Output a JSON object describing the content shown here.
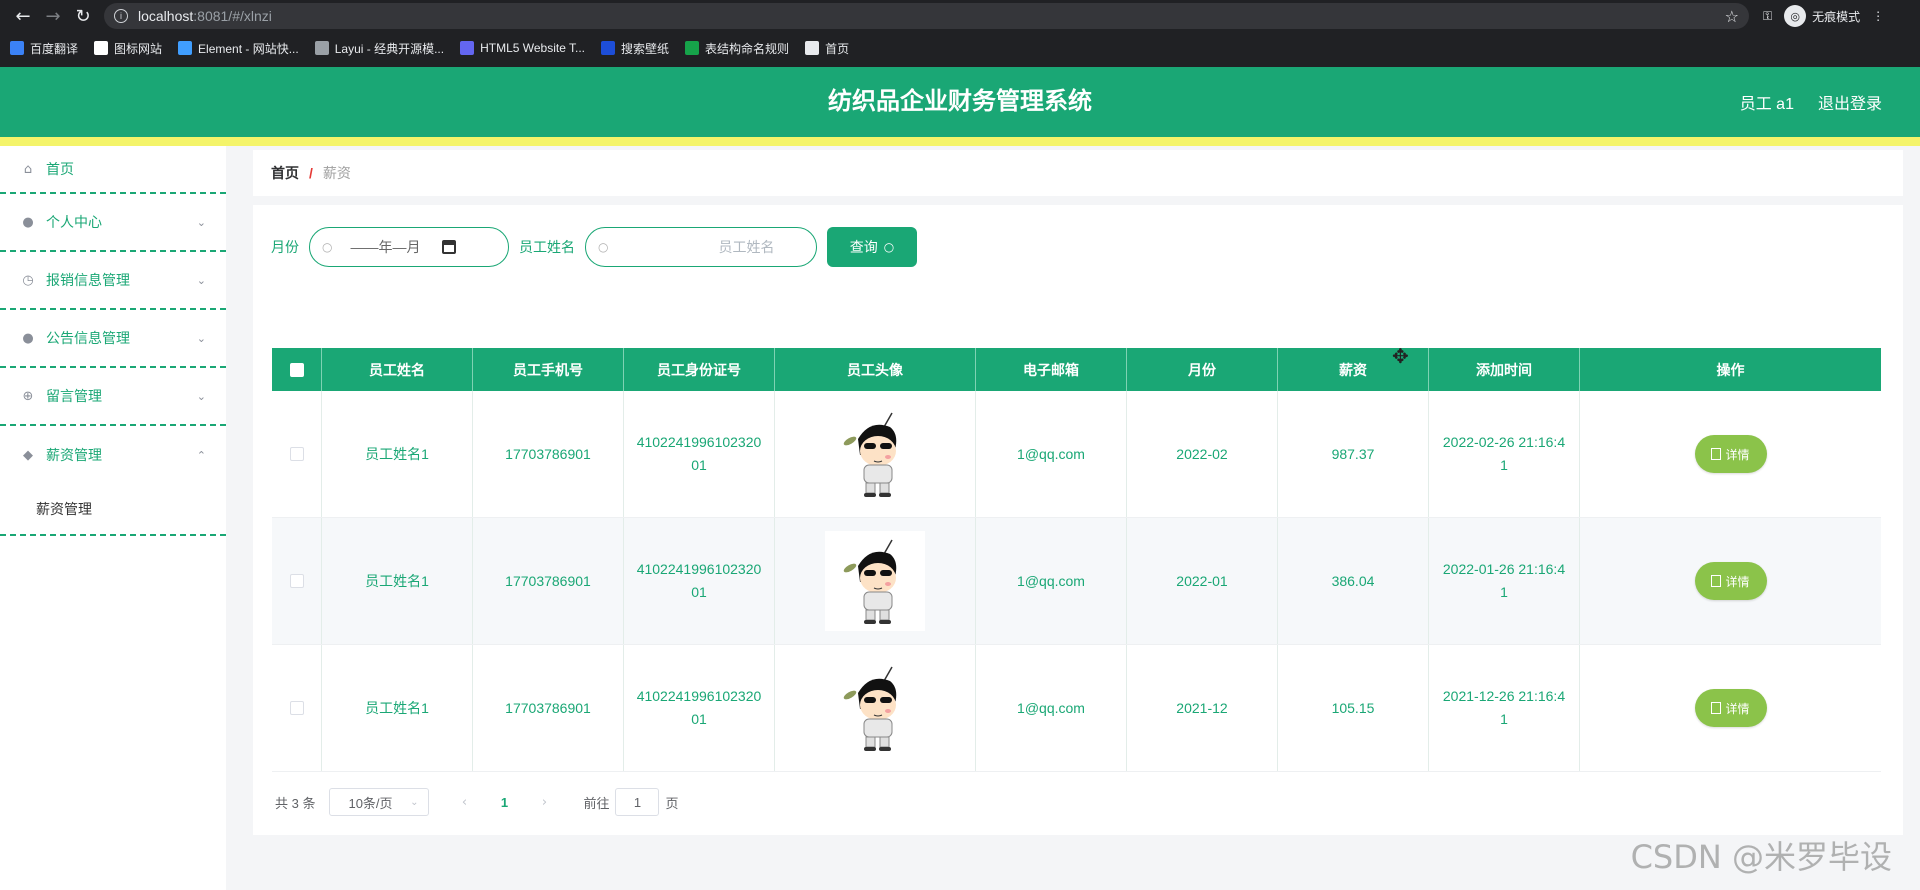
{
  "browser": {
    "url_host": "localhost",
    "url_path": ":8081/#/xlnzi",
    "incognito_label": "无痕模式",
    "bookmarks": [
      {
        "label": "百度翻译",
        "color": "#3b82f6"
      },
      {
        "label": "图标网站",
        "color": "#ffffff"
      },
      {
        "label": "Element - 网站快...",
        "color": "#409eff"
      },
      {
        "label": "Layui - 经典开源模...",
        "color": "#9aa0a6"
      },
      {
        "label": "HTML5 Website T...",
        "color": "#6366f1"
      },
      {
        "label": "搜索壁纸",
        "color": "#1d4ed8"
      },
      {
        "label": "表结构命名规则",
        "color": "#16a34a"
      },
      {
        "label": "首页",
        "color": "#e8eaed"
      }
    ]
  },
  "header": {
    "title": "纺织品企业财务管理系统",
    "user": "员工 a1",
    "logout": "退出登录"
  },
  "sidebar": {
    "items": [
      {
        "label": "首页",
        "icon": "home-icon"
      },
      {
        "label": "个人中心",
        "icon": "user-icon"
      },
      {
        "label": "报销信息管理",
        "icon": "clock-icon"
      },
      {
        "label": "公告信息管理",
        "icon": "user-icon"
      },
      {
        "label": "留言管理",
        "icon": "compass-icon"
      },
      {
        "label": "薪资管理",
        "icon": "location-icon"
      }
    ],
    "submenu": "薪资管理"
  },
  "breadcrumb": {
    "home": "首页",
    "separator": "/",
    "current": "薪资"
  },
  "search": {
    "month_label": "月份",
    "month_value": "——年—月",
    "name_label": "员工姓名",
    "name_placeholder": "员工姓名",
    "query_button": "查询"
  },
  "table": {
    "headers": [
      "员工姓名",
      "员工手机号",
      "员工身份证号",
      "员工头像",
      "电子邮箱",
      "月份",
      "薪资",
      "添加时间",
      "操作"
    ],
    "rows": [
      {
        "name": "员工姓名1",
        "phone": "17703786901",
        "id_card": "410224199610232001",
        "email": "1@qq.com",
        "month": "2022-02",
        "salary": "987.37",
        "added": "2022-02-26 21:16:41"
      },
      {
        "name": "员工姓名1",
        "phone": "17703786901",
        "id_card": "410224199610232001",
        "email": "1@qq.com",
        "month": "2022-01",
        "salary": "386.04",
        "added": "2022-01-26 21:16:41"
      },
      {
        "name": "员工姓名1",
        "phone": "17703786901",
        "id_card": "410224199610232001",
        "email": "1@qq.com",
        "month": "2021-12",
        "salary": "105.15",
        "added": "2021-12-26 21:16:41"
      }
    ],
    "detail_label": "详情"
  },
  "pagination": {
    "total": "共 3 条",
    "page_size": "10条/页",
    "current_page": "1",
    "goto_label": "前往",
    "goto_value": "1",
    "page_suffix": "页"
  },
  "watermark": "CSDN @米罗毕设"
}
